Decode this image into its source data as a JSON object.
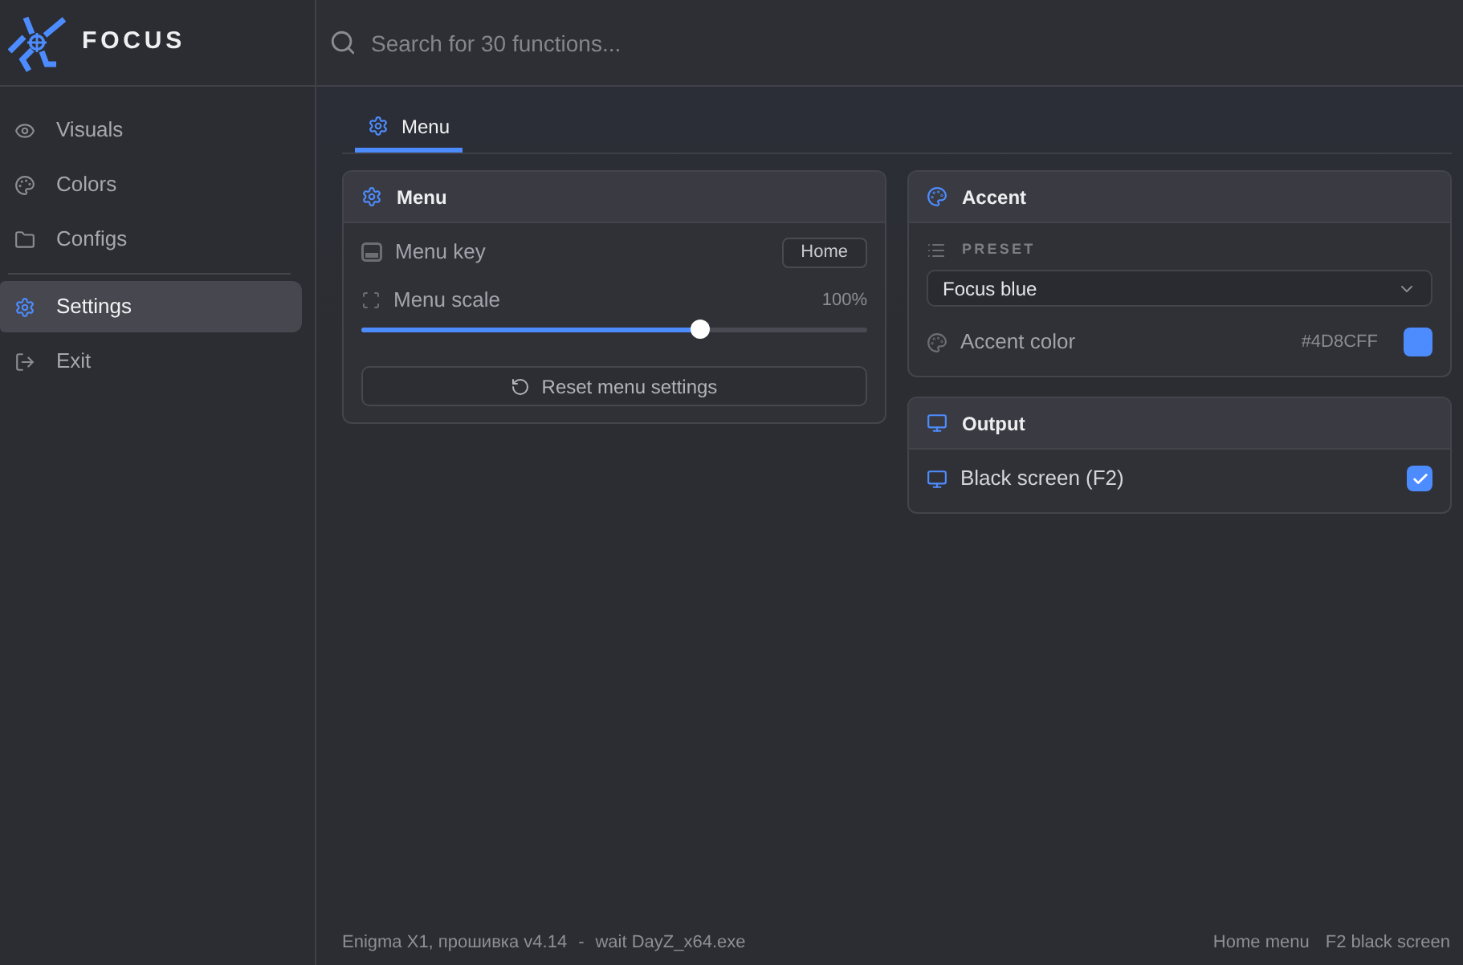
{
  "app": {
    "logo_text": "FOCUS"
  },
  "search": {
    "placeholder": "Search for 30 functions..."
  },
  "sidebar": {
    "sections": [
      {
        "items": [
          {
            "label": "Visuals",
            "selected": false
          },
          {
            "label": "Colors",
            "selected": false
          },
          {
            "label": "Configs",
            "selected": false
          }
        ]
      },
      {
        "items": [
          {
            "label": "Settings",
            "selected": true
          },
          {
            "label": "Exit",
            "selected": false
          }
        ]
      }
    ]
  },
  "tabs": [
    {
      "label": "Menu",
      "selected": true
    }
  ],
  "columns": [
    {
      "panels": [
        {
          "title": "Menu",
          "rows": [
            {
              "kind": "key",
              "label": "Menu key",
              "value": "Home"
            },
            {
              "kind": "slider",
              "label": "Menu scale",
              "reading": "100%",
              "level": 0.67
            },
            {
              "kind": "button",
              "label": "Reset menu settings"
            }
          ]
        }
      ]
    },
    {
      "panels": [
        {
          "title": "Accent",
          "rows": [
            {
              "kind": "select",
              "label": "PRESET",
              "value": "Focus blue"
            },
            {
              "kind": "color",
              "label": "Accent color",
              "value": "#4D8CFF",
              "color": "#4d8cff"
            }
          ]
        },
        {
          "title": "Output",
          "rows": [
            {
              "kind": "checkbox",
              "label": "Black screen (F2)",
              "checked": true
            }
          ]
        }
      ]
    }
  ],
  "status_bar": {
    "left": [
      "Enigma X1, прошивка v4.14",
      "-",
      "wait DayZ_x64.exe"
    ],
    "right": [
      "Home menu",
      "F2 black screen"
    ]
  }
}
